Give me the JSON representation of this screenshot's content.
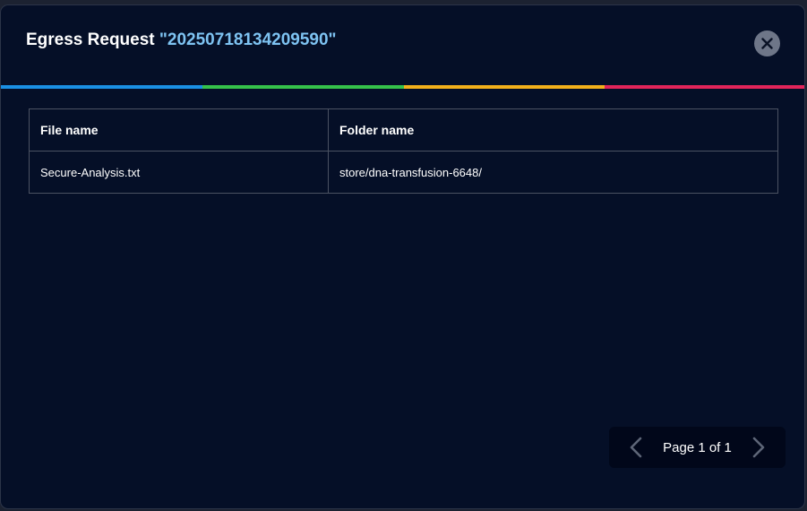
{
  "dialog": {
    "title_prefix": "Egress Request",
    "request_id": "\"20250718134209590\"",
    "close_icon": "close-icon"
  },
  "colors": {
    "background": "#050f27",
    "title_id": "#7ec3f2",
    "accent": [
      "#1a8fe3",
      "#35c24a",
      "#f2b01b",
      "#e2245a"
    ],
    "close_button": "#6e7688",
    "pager_background": "#01071a"
  },
  "table": {
    "headers": [
      "File name",
      "Folder name"
    ],
    "rows": [
      [
        "Secure-Analysis.txt",
        "store/dna-transfusion-6648/"
      ]
    ]
  },
  "pagination": {
    "label": "Page 1 of 1",
    "prev_icon": "chevron-left-icon",
    "next_icon": "chevron-right-icon"
  }
}
